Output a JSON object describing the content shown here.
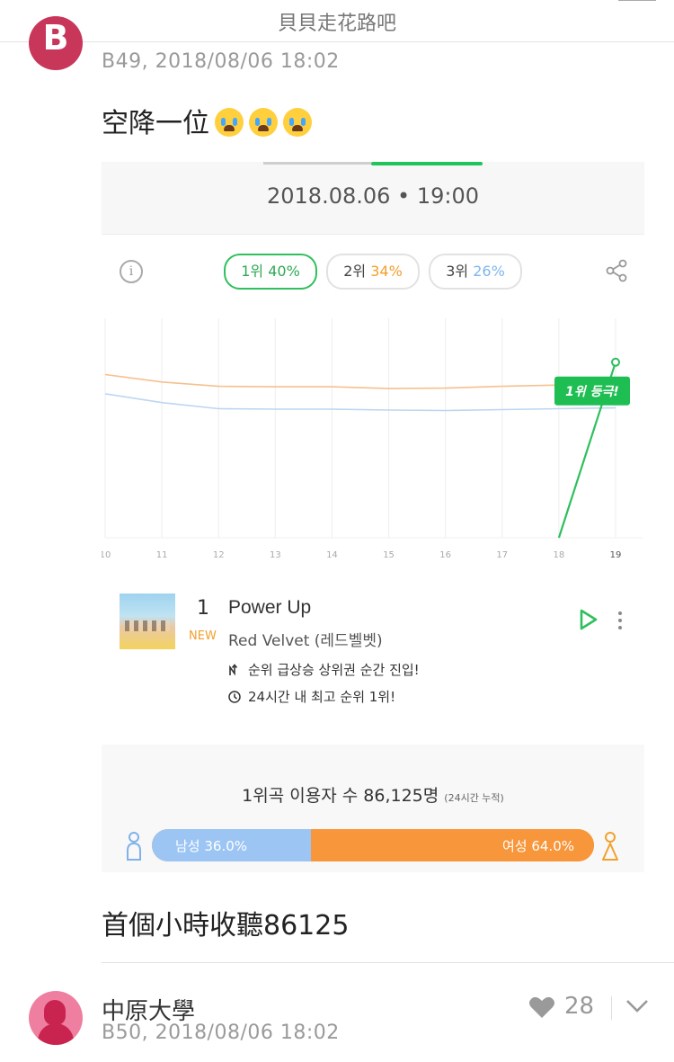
{
  "header": {
    "title": "貝貝走花路吧"
  },
  "post1": {
    "avatar_letter": "B",
    "floor_time": "B49, 2018/08/06 18:02",
    "text": "空降一位",
    "emoji_icons": [
      "loudly-crying-face-icon",
      "loudly-crying-face-icon",
      "loudly-crying-face-icon"
    ]
  },
  "chart_card": {
    "date": "2018.08.06 • 19:00",
    "pills": [
      {
        "rank": "1위",
        "pct": "40%",
        "color": "#2fa855",
        "active": true
      },
      {
        "rank": "2위",
        "pct": "34%",
        "color": "#f3a02c",
        "active": false
      },
      {
        "rank": "3위",
        "pct": "26%",
        "color": "#7fb6ec",
        "active": false
      }
    ],
    "badge": "1위 등극!",
    "song": {
      "rank": "1",
      "new_tag": "NEW",
      "title": "Power Up",
      "artist": "Red Velvet (레드벨벳)",
      "features": [
        {
          "icon": "rank-jump-icon",
          "text": "순위 급상승 상위권 순간 진입!"
        },
        {
          "icon": "clock-icon",
          "text": "24시간 내 최고 순위 1위!"
        }
      ]
    },
    "stats": {
      "label": "1위곡 이용자 수",
      "count": "86,125명",
      "period": "(24시간 누적)",
      "male_label": "남성 36.0%",
      "female_label": "여성 64.0%",
      "male_pct": 36.0,
      "female_pct": 64.0
    }
  },
  "chart_data": {
    "type": "line",
    "x": [
      "10",
      "11",
      "12",
      "13",
      "14",
      "15",
      "16",
      "17",
      "18",
      "19"
    ],
    "series": [
      {
        "name": "1위",
        "color": "#2fbf5d",
        "values": [
          null,
          null,
          null,
          null,
          null,
          null,
          null,
          null,
          0,
          40
        ]
      },
      {
        "name": "2위",
        "color": "#f6c08e",
        "values": [
          37.2,
          35.5,
          34.5,
          34.4,
          34.4,
          34.0,
          34.1,
          34.5,
          34.8,
          35.0
        ]
      },
      {
        "name": "3위",
        "color": "#bcd6f2",
        "values": [
          32.8,
          30.8,
          29.4,
          29.3,
          29.3,
          29.1,
          29.0,
          29.2,
          29.4,
          29.6
        ]
      }
    ],
    "ylim": [
      0,
      50
    ],
    "grid": true
  },
  "post2": {
    "caption": "首個小時收聽86125",
    "username": "中原大學",
    "floor_time": "B50, 2018/08/06 18:02",
    "likes": "28"
  }
}
